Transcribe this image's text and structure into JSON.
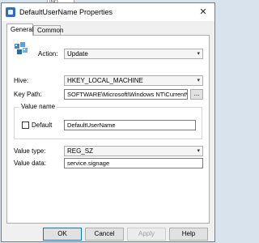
{
  "background": {
    "fragment_text": "INO"
  },
  "window": {
    "title": "DefaultUserName Properties",
    "close_glyph": "✕"
  },
  "tabs": [
    {
      "label": "General",
      "active": true
    },
    {
      "label": "Common",
      "active": false
    }
  ],
  "form": {
    "action": {
      "label": "Action:",
      "value": "Update"
    },
    "hive": {
      "label": "Hive:",
      "value": "HKEY_LOCAL_MACHINE"
    },
    "key_path": {
      "label": "Key Path:",
      "value": "SOFTWARE\\Microsoft\\Windows NT\\CurrentVer",
      "browse_label": "..."
    },
    "value_name": {
      "group_label": "Value name",
      "default_label": "Default",
      "default_checked": false,
      "value": "DefaultUserName"
    },
    "value_type": {
      "label": "Value type:",
      "value": "REG_SZ"
    },
    "value_data": {
      "label": "Value data:",
      "value": "service.signage"
    }
  },
  "buttons": {
    "ok": "OK",
    "cancel": "Cancel",
    "apply": "Apply",
    "help": "Help"
  },
  "icons": {
    "dropdown_arrow": "▾",
    "app_icon": "registry-icon"
  },
  "colors": {
    "window_bg": "#f0f0f0",
    "panel_bg": "#ffffff",
    "default_button_border": "#0078d7"
  }
}
